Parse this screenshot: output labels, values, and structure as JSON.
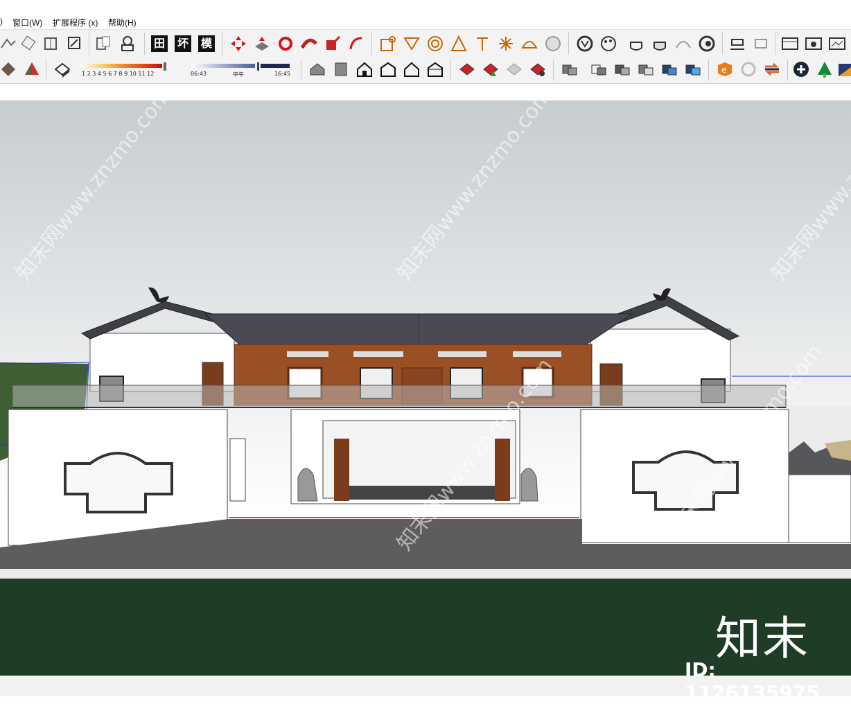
{
  "menu": {
    "paren": ")",
    "window": "窗口(W)",
    "extensions": "扩展程序 (x)",
    "help": "帮助(H)"
  },
  "toolbar": {
    "kanji_buttons": [
      "田",
      "坏",
      "模"
    ],
    "shadow_months": "1 2 3 4 5 6 7 8 9 10 11 12",
    "time_start": "06:43",
    "time_mid": "中午",
    "time_end": "16:45"
  },
  "watermark": {
    "site": "知末网www.znzmo.com",
    "brand": "知末",
    "id": "ID: 1126135975"
  },
  "colors": {
    "sky_top": "#c7cccf",
    "wall_white": "#ffffff",
    "roof_dark": "#4a4a52",
    "wood": "#9b4f24",
    "lawn": "#1f3d26",
    "paving": "#5a5a5a"
  }
}
